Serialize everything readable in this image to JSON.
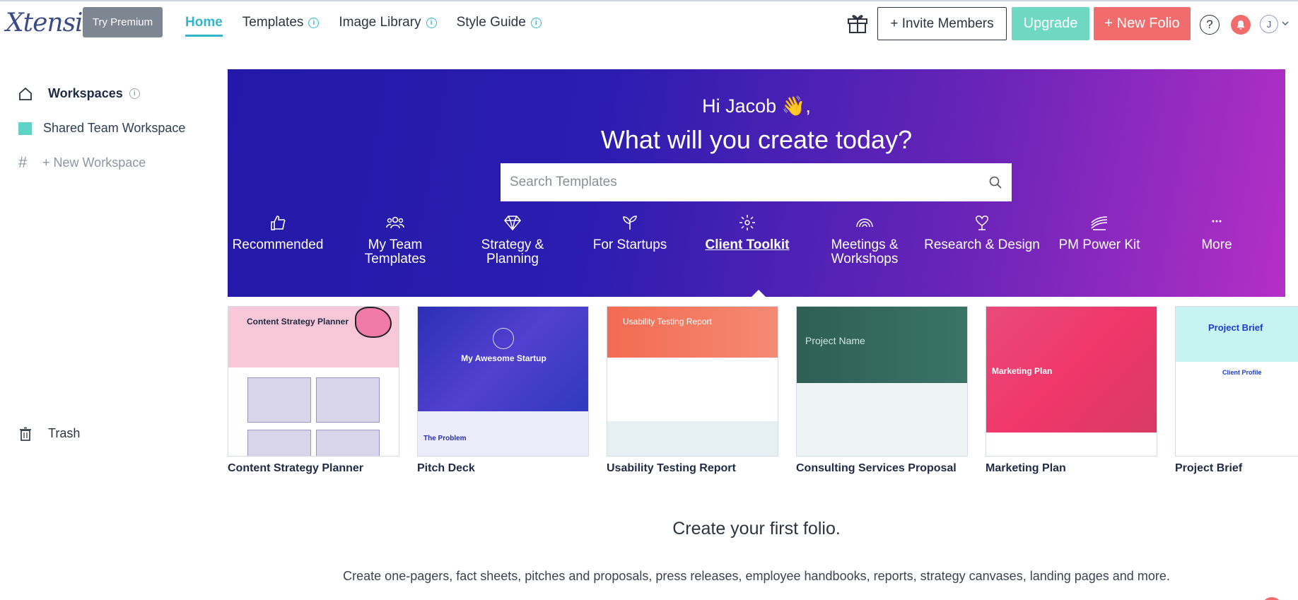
{
  "app": {
    "logo_text": "Xtensio"
  },
  "header": {
    "try_premium": "Try Premium",
    "nav": [
      {
        "label": "Home",
        "active": true,
        "info": false
      },
      {
        "label": "Templates",
        "active": false,
        "info": true
      },
      {
        "label": "Image Library",
        "active": false,
        "info": true
      },
      {
        "label": "Style Guide",
        "active": false,
        "info": true
      }
    ],
    "invite": "+ Invite Members",
    "upgrade": "Upgrade",
    "new_folio": "+ New Folio",
    "help": "?",
    "avatar_initial": "J"
  },
  "sidebar": {
    "workspaces": "Workspaces",
    "shared_workspace": "Shared Team Workspace",
    "new_workspace": "+ New Workspace",
    "trash": "Trash"
  },
  "hero": {
    "greeting": "Hi Jacob 👋,",
    "headline": "What will you create today?",
    "search_placeholder": "Search Templates",
    "categories": [
      {
        "label": "Recommended",
        "icon": "thumbs-up-icon"
      },
      {
        "label": "My Team Templates",
        "icon": "team-icon"
      },
      {
        "label": "Strategy & Planning",
        "icon": "diamond-icon"
      },
      {
        "label": "For Startups",
        "icon": "sprout-icon"
      },
      {
        "label": "Client Toolkit",
        "icon": "sparkle-icon",
        "active": true
      },
      {
        "label": "Meetings & Workshops",
        "icon": "rainbow-icon"
      },
      {
        "label": "Research & Design",
        "icon": "heart-stand-icon"
      },
      {
        "label": "PM Power Kit",
        "icon": "fields-icon"
      },
      {
        "label": "More",
        "icon": "more-dots-icon"
      }
    ]
  },
  "templates": [
    {
      "title": "Content Strategy Planner",
      "thumb_heading": "Content Strategy Planner"
    },
    {
      "title": "Pitch Deck",
      "thumb_heading": "My Awesome Startup",
      "thumb_sub": "The Problem"
    },
    {
      "title": "Usability Testing Report",
      "thumb_heading": "Usability Testing Report"
    },
    {
      "title": "Consulting Services Proposal",
      "thumb_heading": "Project Name"
    },
    {
      "title": "Marketing Plan",
      "thumb_heading": "Marketing Plan"
    },
    {
      "title": "Project Brief",
      "thumb_heading": "Project Brief",
      "thumb_sub": "Client Profile"
    }
  ],
  "empty_state": {
    "title": "Create your first folio.",
    "subtitle": "Create one-pagers, fact sheets, pitches and proposals, press releases, employee handbooks, reports, strategy canvases, landing pages and more."
  },
  "colors": {
    "accent": "#33b6cc",
    "upgrade": "#6fd8c2",
    "new_folio": "#f16c6c",
    "hero_start": "#2319a8",
    "hero_end": "#b42fc6",
    "workspace_swatch": "#5fd3c5"
  }
}
